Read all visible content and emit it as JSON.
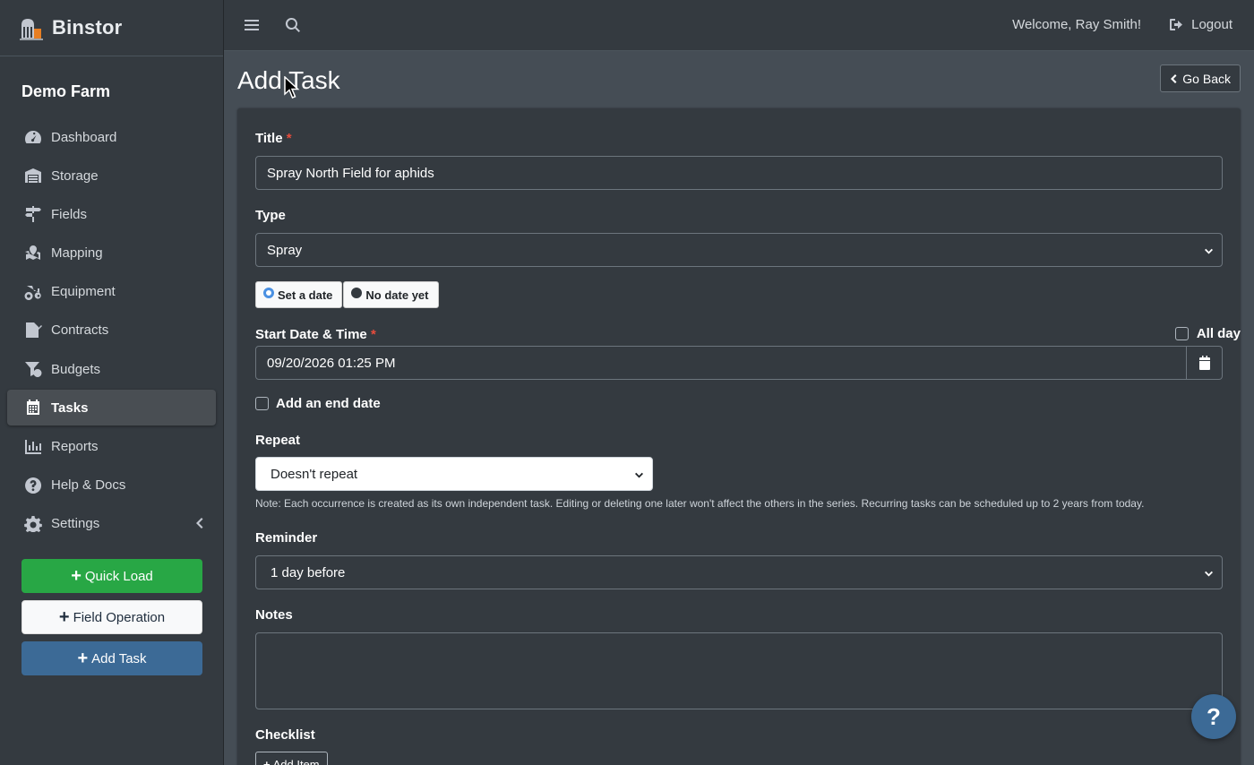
{
  "brand": {
    "name": "Binstor"
  },
  "sidebar": {
    "farm_name": "Demo Farm",
    "items": [
      {
        "label": "Dashboard",
        "icon": "dashboard-icon"
      },
      {
        "label": "Storage",
        "icon": "warehouse-icon"
      },
      {
        "label": "Fields",
        "icon": "signpost-icon"
      },
      {
        "label": "Mapping",
        "icon": "map-marker-icon"
      },
      {
        "label": "Equipment",
        "icon": "tractor-icon"
      },
      {
        "label": "Contracts",
        "icon": "file-contract-icon"
      },
      {
        "label": "Budgets",
        "icon": "funnel-dollar-icon"
      },
      {
        "label": "Tasks",
        "icon": "calendar-icon",
        "active": true
      },
      {
        "label": "Reports",
        "icon": "chart-bar-icon"
      },
      {
        "label": "Help & Docs",
        "icon": "question-circle-icon"
      },
      {
        "label": "Settings",
        "icon": "gear-icon"
      }
    ],
    "quick_load": "Quick Load",
    "field_operation": "Field Operation",
    "add_task": "Add Task"
  },
  "topbar": {
    "welcome": "Welcome, Ray Smith!",
    "logout": "Logout"
  },
  "page": {
    "title": "Add Task",
    "go_back": "Go Back"
  },
  "form": {
    "title_label": "Title",
    "title_value": "Spray North Field for aphids",
    "type_label": "Type",
    "type_value": "Spray",
    "date_mode_options": [
      "Set a date",
      "No date yet"
    ],
    "start_label": "Start Date & Time",
    "all_day_label": "All day",
    "start_value": "09/20/2026 01:25 PM",
    "end_date_label": "Add an end date",
    "repeat_label": "Repeat",
    "repeat_value": "Doesn't repeat",
    "repeat_note": "Note: Each occurrence is created as its own independent task. Editing or deleting one later won't affect the others in the series. Recurring tasks can be scheduled up to 2 years from today.",
    "reminder_label": "Reminder",
    "reminder_value": "1 day before",
    "notes_label": "Notes",
    "checklist_label": "Checklist",
    "add_item": "Add Item"
  },
  "help_fab": "?",
  "colors": {
    "sidebar_bg": "#343a40",
    "content_bg": "#454d55",
    "green": "#28a745",
    "blue": "#3c6a96",
    "required": "#e74c3c"
  }
}
